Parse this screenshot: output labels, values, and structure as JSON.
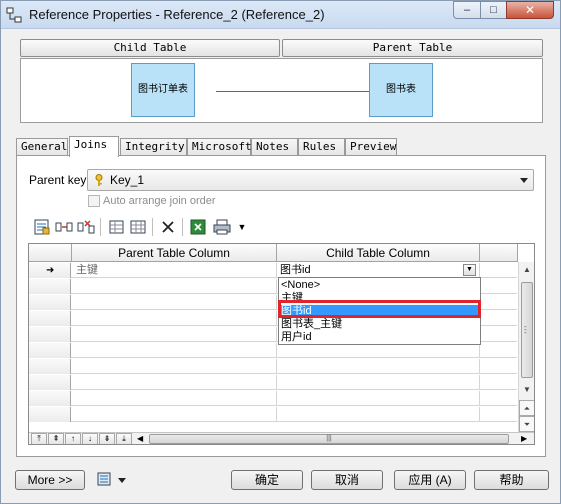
{
  "window": {
    "title": "Reference Properties - Reference_2 (Reference_2)",
    "controls": {
      "minimize": "–",
      "maximize": "□",
      "close": "✕"
    }
  },
  "header": {
    "child_table": "Child Table",
    "parent_table": "Parent Table"
  },
  "diagram": {
    "child_entity": "图书订单表",
    "parent_entity": "图书表",
    "line_color": "#2a7aa8",
    "entity_fill": "#b9e1f7"
  },
  "tabs": [
    {
      "label": "General"
    },
    {
      "label": "Joins"
    },
    {
      "label": "Integrity"
    },
    {
      "label": "Microsoft"
    },
    {
      "label": "Notes"
    },
    {
      "label": "Rules"
    },
    {
      "label": "Preview"
    }
  ],
  "active_tab": "Joins",
  "joins": {
    "parent_key_label": "Parent key:",
    "parent_key_value": "Key_1",
    "auto_arrange_label": "Auto arrange join order",
    "auto_arrange_checked": false,
    "toolbar_icons": [
      "properties-icon",
      "insert-row-icon",
      "delete-column-icon",
      "add-row-icon",
      "table-grid-icon",
      "delete-icon",
      "excel-export-icon",
      "print-icon",
      "dropdown-arrow-icon"
    ],
    "columns": [
      "Parent Table Column",
      "Child Table Column"
    ],
    "rows": [
      {
        "parent": "主键",
        "child": "图书id",
        "current": true
      }
    ],
    "dropdown_options": [
      "<None>",
      "主键",
      "图书id",
      "图书表_主键",
      "用户id"
    ],
    "dropdown_selected": "图书id",
    "highlight_color": "#e0242b",
    "selection_color": "#3399ff"
  },
  "nav_icons": [
    "move-top-icon",
    "move-up-page-icon",
    "move-up-icon",
    "move-down-icon",
    "move-down-page-icon",
    "move-bottom-icon"
  ],
  "footer": {
    "more": "More >>",
    "ok": "确定",
    "cancel": "取消",
    "apply": "应用 (A)",
    "help": "帮助"
  }
}
